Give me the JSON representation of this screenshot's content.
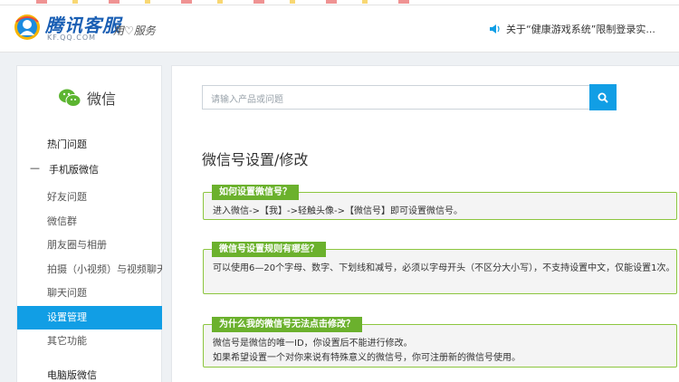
{
  "header": {
    "brand": "腾讯客服",
    "brand_sub": "KF.QQ.COM",
    "slogan": "用♡服务",
    "notice": "关于“健康游戏系统”限制登录实..."
  },
  "sidebar": {
    "product": "微信",
    "hot": "热门问题",
    "category_toggle": "—",
    "category": "手机版微信",
    "items": [
      {
        "label": "好友问题"
      },
      {
        "label": "微信群"
      },
      {
        "label": "朋友圈与相册"
      },
      {
        "label": "拍摄（小视频）与视频聊天"
      },
      {
        "label": "聊天问题"
      },
      {
        "label": "设置管理"
      },
      {
        "label": "其它功能"
      }
    ],
    "pc": "电脑版微信"
  },
  "search": {
    "placeholder": "请输入产品或问题"
  },
  "main": {
    "title": "微信号设置/修改",
    "qa": [
      {
        "question": "如何设置微信号？",
        "lines": [
          "进入微信->【我】->轻触头像->【微信号】即可设置微信号。"
        ]
      },
      {
        "question": "微信号设置规则有哪些？",
        "lines": [
          "可以使用6—20个字母、数字、下划线和减号，必须以字母开头（不区分大小写），不支持设置中文，仅能设置1次。"
        ]
      },
      {
        "question": "为什么我的微信号无法点击修改？",
        "lines": [
          "微信号是微信的唯一ID，你设置后不能进行修改。",
          "如果希望设置一个对你来说有特殊意义的微信号，你可注册新的微信号使用。"
        ]
      }
    ]
  },
  "colors": {
    "accent_blue": "#119ee5",
    "tag_green": "#6bb12d",
    "brand_blue": "#1a5fb4"
  }
}
